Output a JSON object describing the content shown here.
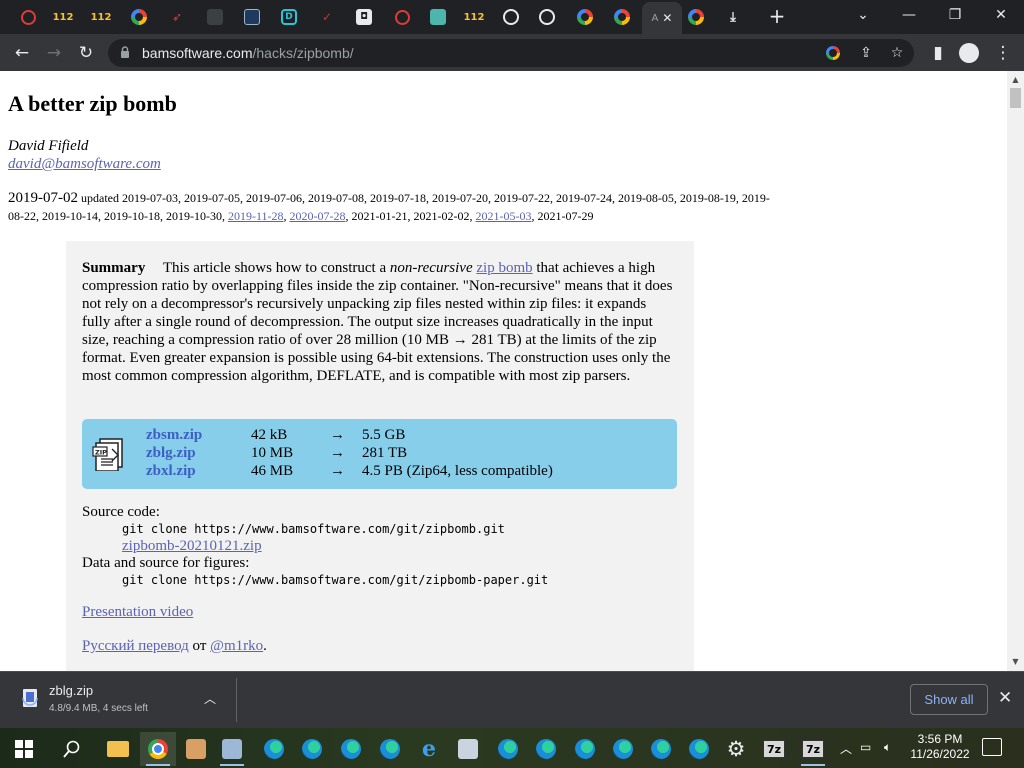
{
  "browser": {
    "active_tab_title": "A",
    "url_domain": "bamsoftware.com",
    "url_path": "/hacks/zipbomb/",
    "tabs": [
      {
        "icon": "quora-icon"
      },
      {
        "icon": "n112-icon",
        "label": "112"
      },
      {
        "icon": "n112-icon",
        "label": "112"
      },
      {
        "icon": "google-icon"
      },
      {
        "icon": "red-logo-icon"
      },
      {
        "icon": "dark-icon"
      },
      {
        "icon": "mail-icon"
      },
      {
        "icon": "d-logo-icon",
        "label": "D"
      },
      {
        "icon": "check-icon"
      },
      {
        "icon": "shield-icon"
      },
      {
        "icon": "quora-icon"
      },
      {
        "icon": "picture-icon"
      },
      {
        "icon": "n112-icon",
        "label": "112"
      },
      {
        "icon": "github-icon"
      },
      {
        "icon": "github-icon"
      },
      {
        "icon": "google-icon"
      },
      {
        "icon": "google-icon"
      },
      {
        "icon": "active-tab"
      },
      {
        "icon": "google-icon"
      },
      {
        "icon": "download-icon"
      }
    ]
  },
  "page": {
    "title": "A better zip bomb",
    "author": "David Fifield",
    "email": "david@bamsoftware.com",
    "date_main": "2019-07-02",
    "updated_prefix": "updated",
    "updated_dates_plain_1": "2019-07-03, 2019-07-05, 2019-07-06, 2019-07-08, 2019-07-18, 2019-07-20, 2019-07-22, 2019-07-24, 2019-08-05, 2019-08-19, 2019-08-22, 2019-10-14, 2019-10-18, 2019-10-30,",
    "updated_link_1": "2019-11-28",
    "updated_link_2": "2020-07-28",
    "updated_plain_2": ", 2021-01-21, 2021-02-02,",
    "updated_link_3": "2021-05-03",
    "updated_plain_3": ", 2021-07-29",
    "summary_label": "Summary",
    "summary_1": "This article shows how to construct a",
    "summary_em": "non-recursive",
    "summary_link": "zip bomb",
    "summary_2": "that achieves a high compression ratio by overlapping files inside the zip container. \"Non-recursive\" means that it does not rely on a decompressor's recursively unpacking zip files nested within zip files: it expands fully after a single round of decompression. The output size increases quadratically in the input size, reaching a compression ratio of over 28 million (10 MB → 281 TB) at the limits of the zip format. Even greater expansion is possible using 64-bit extensions. The construction uses only the most common compression algorithm, DEFLATE, and is compatible with most zip parsers.",
    "files": [
      {
        "name": "zbsm.zip",
        "size": "42 kB",
        "arrow": "→",
        "output": "5.5 GB"
      },
      {
        "name": "zblg.zip",
        "size": "10 MB",
        "arrow": "→",
        "output": "281 TB"
      },
      {
        "name": "zbxl.zip",
        "size": "46 MB",
        "arrow": "→",
        "output": "4.5 PB (Zip64, less compatible)"
      }
    ],
    "source_label": "Source code:",
    "source_git": "git clone https://www.bamsoftware.com/git/zipbomb.git",
    "source_zip": "zipbomb-20210121.zip",
    "data_label": "Data and source for figures:",
    "data_git": "git clone https://www.bamsoftware.com/git/zipbomb-paper.git",
    "presentation": "Presentation video",
    "russian_link": "Русский перевод",
    "russian_from": "от",
    "russian_author": "@m1rko",
    "russian_end": "."
  },
  "download": {
    "filename": "zblg.zip",
    "status": "4.8/9.4 MB, 4 secs left",
    "show_all": "Show all"
  },
  "taskbar": {
    "time": "3:56 PM",
    "date": "11/26/2022",
    "sevenzip_label": "7z"
  }
}
